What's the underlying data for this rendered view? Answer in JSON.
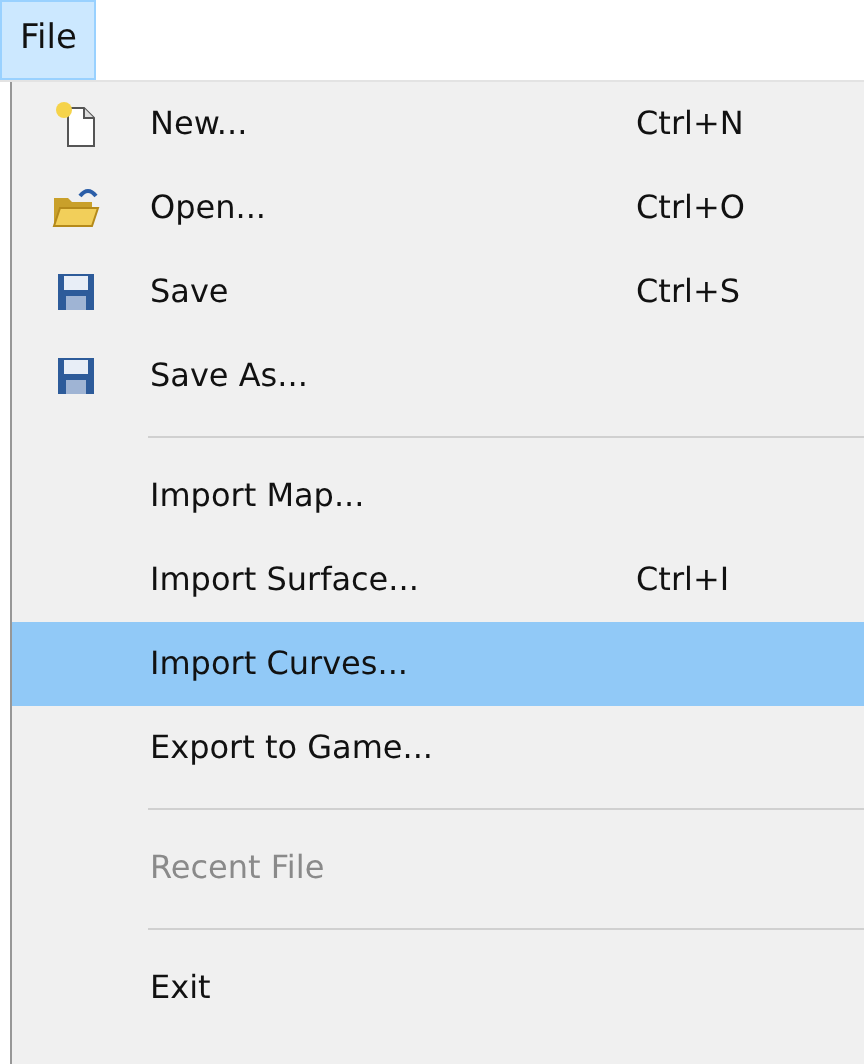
{
  "menu_bar": [
    {
      "label": "File",
      "selected": true
    }
  ],
  "menu": [
    {
      "kind": "item",
      "label": "New...",
      "shortcut": "Ctrl+N",
      "selected": false,
      "disabled": false
    },
    {
      "kind": "item",
      "label": "Open...",
      "shortcut": "Ctrl+O",
      "selected": false,
      "disabled": false
    },
    {
      "kind": "item",
      "label": "Save",
      "shortcut": "Ctrl+S",
      "selected": false,
      "disabled": false
    },
    {
      "kind": "item",
      "label": "Save As...",
      "selected": false,
      "disabled": false
    },
    {
      "kind": "separator"
    },
    {
      "kind": "item",
      "label": "Import Map...",
      "selected": false,
      "disabled": false
    },
    {
      "kind": "item",
      "label": "Import Surface...",
      "shortcut": "Ctrl+I",
      "selected": false,
      "disabled": false
    },
    {
      "kind": "item",
      "label": "Import Curves...",
      "selected": true,
      "disabled": false
    },
    {
      "kind": "item",
      "label": "Export to Game...",
      "selected": false,
      "disabled": false
    },
    {
      "kind": "separator"
    },
    {
      "kind": "item",
      "label": "Recent File",
      "selected": false,
      "disabled": true
    },
    {
      "kind": "separator"
    },
    {
      "kind": "item",
      "label": "Exit",
      "selected": false,
      "disabled": false
    }
  ]
}
